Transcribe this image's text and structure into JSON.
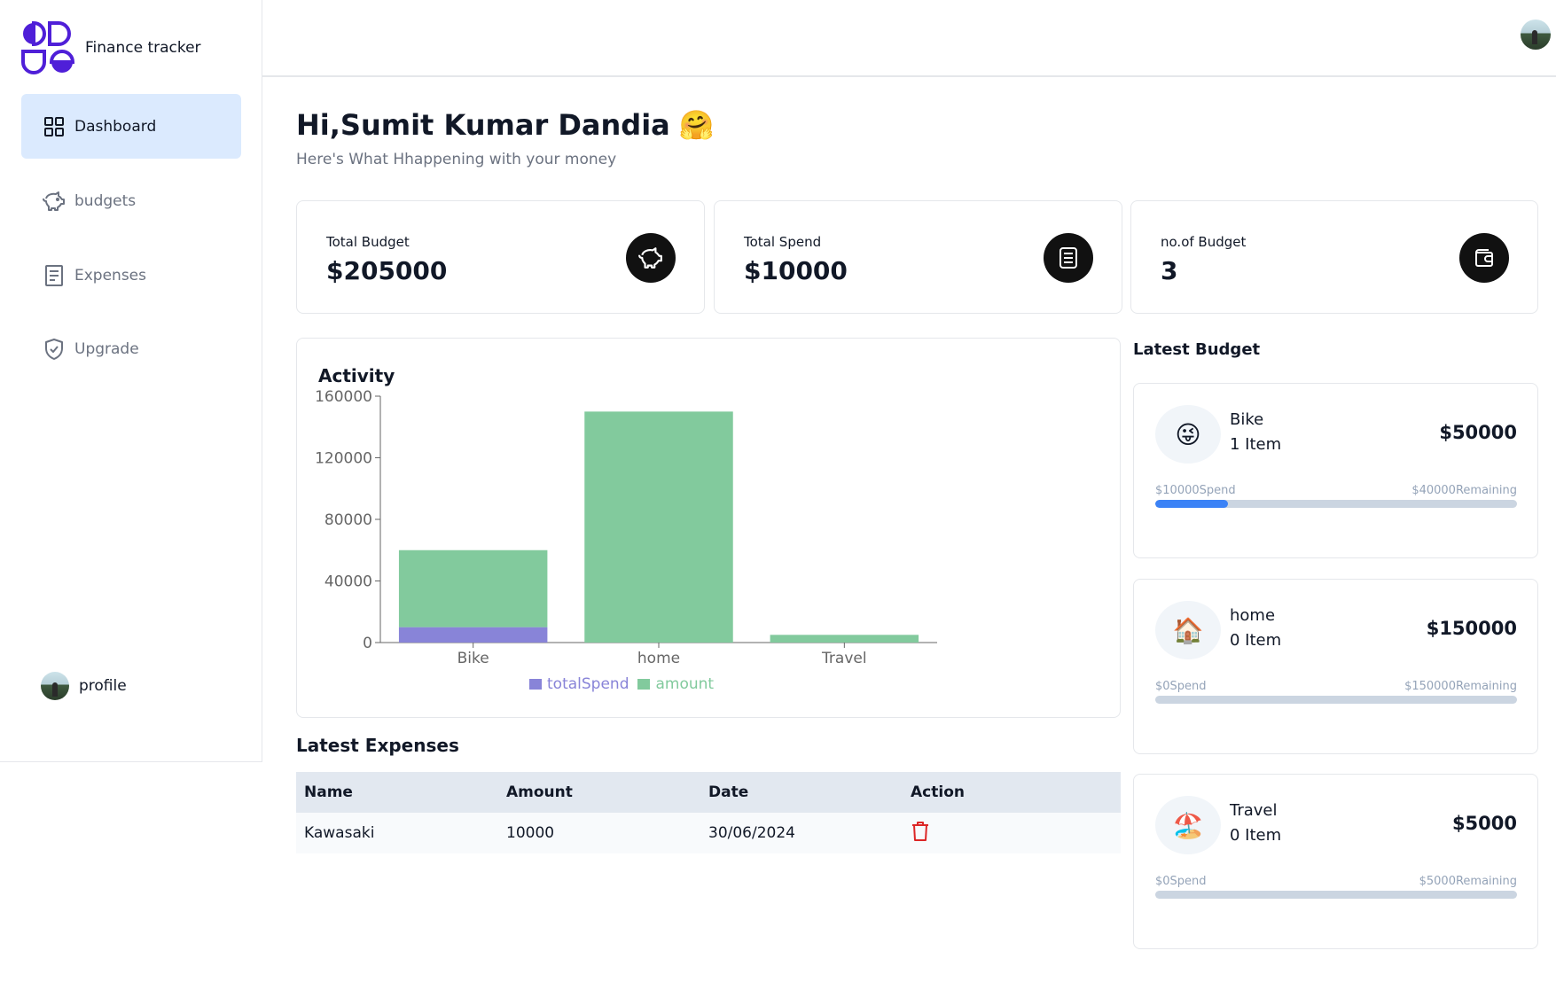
{
  "app": {
    "name": "Finance tracker"
  },
  "sidebar": {
    "items": [
      {
        "label": "Dashboard",
        "icon": "dashboard-grid-icon",
        "active": true
      },
      {
        "label": "budgets",
        "icon": "piggy-bank-icon",
        "active": false
      },
      {
        "label": "Expenses",
        "icon": "receipt-icon",
        "active": false
      },
      {
        "label": "Upgrade",
        "icon": "shield-check-icon",
        "active": false
      }
    ],
    "profile_label": "profile"
  },
  "header": {
    "greeting": "Hi,Sumit Kumar Dandia",
    "greeting_emoji": "🤗",
    "subtitle": "Here's What Hhappening with your money"
  },
  "stats": [
    {
      "label": "Total Budget",
      "value": "$205000",
      "icon": "piggy-bank-icon"
    },
    {
      "label": "Total Spend",
      "value": "$10000",
      "icon": "receipt-icon"
    },
    {
      "label": "no.of Budget",
      "value": "3",
      "icon": "wallet-icon"
    }
  ],
  "activity": {
    "title": "Activity"
  },
  "chart_data": {
    "type": "bar",
    "stacked": true,
    "title": "Activity",
    "categories": [
      "Bike",
      "home",
      "Travel"
    ],
    "series": [
      {
        "name": "totalSpend",
        "values": [
          10000,
          0,
          0
        ],
        "color": "#8884d8"
      },
      {
        "name": "amount",
        "values": [
          50000,
          150000,
          5000
        ],
        "color": "#82ca9d"
      }
    ],
    "ylim": [
      0,
      160000
    ],
    "yticks": [
      0,
      40000,
      80000,
      120000,
      160000
    ],
    "ytick_labels": [
      "0",
      "40000",
      "80000",
      "120000",
      "160000"
    ],
    "legend": "bottom"
  },
  "expenses": {
    "title": "Latest Expenses",
    "columns": [
      "Name",
      "Amount",
      "Date",
      "Action"
    ],
    "rows": [
      {
        "name": "Kawasaki",
        "amount": "10000",
        "date": "30/06/2024",
        "action_icon": "trash-icon"
      }
    ]
  },
  "latest_budget": {
    "title": "Latest Budget",
    "items": [
      {
        "emoji": "😜",
        "name": "Bike",
        "items": "1 Item",
        "amount": "$50000",
        "spend": "$10000Spend",
        "remaining": "$40000Remaining",
        "progress": 0.2
      },
      {
        "emoji": "🏠",
        "name": "home",
        "items": "0 Item",
        "amount": "$150000",
        "spend": "$0Spend",
        "remaining": "$150000Remaining",
        "progress": 0
      },
      {
        "emoji": "🏖️",
        "name": "Travel",
        "items": "0 Item",
        "amount": "$5000",
        "spend": "$0Spend",
        "remaining": "$5000Remaining",
        "progress": 0
      }
    ]
  },
  "colors": {
    "brand": "#4f1fd8",
    "active_nav_bg": "#dbeafe",
    "progress_fill": "#3b82f6",
    "delete_icon": "#dc2626"
  }
}
